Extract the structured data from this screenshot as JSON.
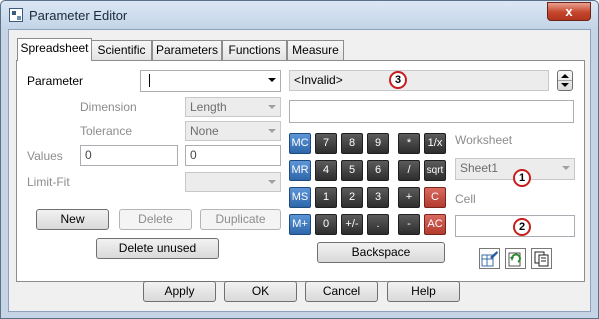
{
  "window": {
    "title": "Parameter Editor",
    "close_glyph": "x"
  },
  "tabs": [
    {
      "label": "Spreadsheet",
      "active": true
    },
    {
      "label": "Scientific"
    },
    {
      "label": "Parameters"
    },
    {
      "label": "Functions"
    },
    {
      "label": "Measure"
    }
  ],
  "form": {
    "parameter_label": "Parameter",
    "parameter_value": "",
    "dimension_label": "Dimension",
    "dimension_value": "Length",
    "tolerance_label": "Tolerance",
    "tolerance_value": "None",
    "values_label": "Values",
    "value_1": "0",
    "value_2": "0",
    "limit_fit_label": "Limit-Fit",
    "limit_fit_value": ""
  },
  "expression": {
    "display": "<Invalid>",
    "input": ""
  },
  "worksheet": {
    "label": "Worksheet",
    "value": "Sheet1"
  },
  "cell": {
    "label": "Cell",
    "value": ""
  },
  "markers": [
    "1",
    "2",
    "3"
  ],
  "buttons": {
    "new": "New",
    "delete": "Delete",
    "duplicate": "Duplicate",
    "delete_unused": "Delete unused",
    "backspace": "Backspace",
    "apply": "Apply",
    "ok": "OK",
    "cancel": "Cancel",
    "help": "Help"
  },
  "keypad": {
    "row1": [
      "MC",
      "7",
      "8",
      "9",
      "*",
      "1/x"
    ],
    "row2": [
      "MR",
      "4",
      "5",
      "6",
      "/",
      "sqrt"
    ],
    "row3": [
      "MS",
      "1",
      "2",
      "3",
      "+",
      "C"
    ],
    "row4": [
      "M+",
      "0",
      "+/-",
      ".",
      "-",
      "AC"
    ]
  },
  "icons": [
    "insert-cell-icon",
    "refresh-icon",
    "copy-icon"
  ],
  "colors": {
    "memory_key": "#2d66aa",
    "digit_key": "#2d2d2d",
    "clear_key": "#b33a2e",
    "marker": "#c81d1d"
  }
}
